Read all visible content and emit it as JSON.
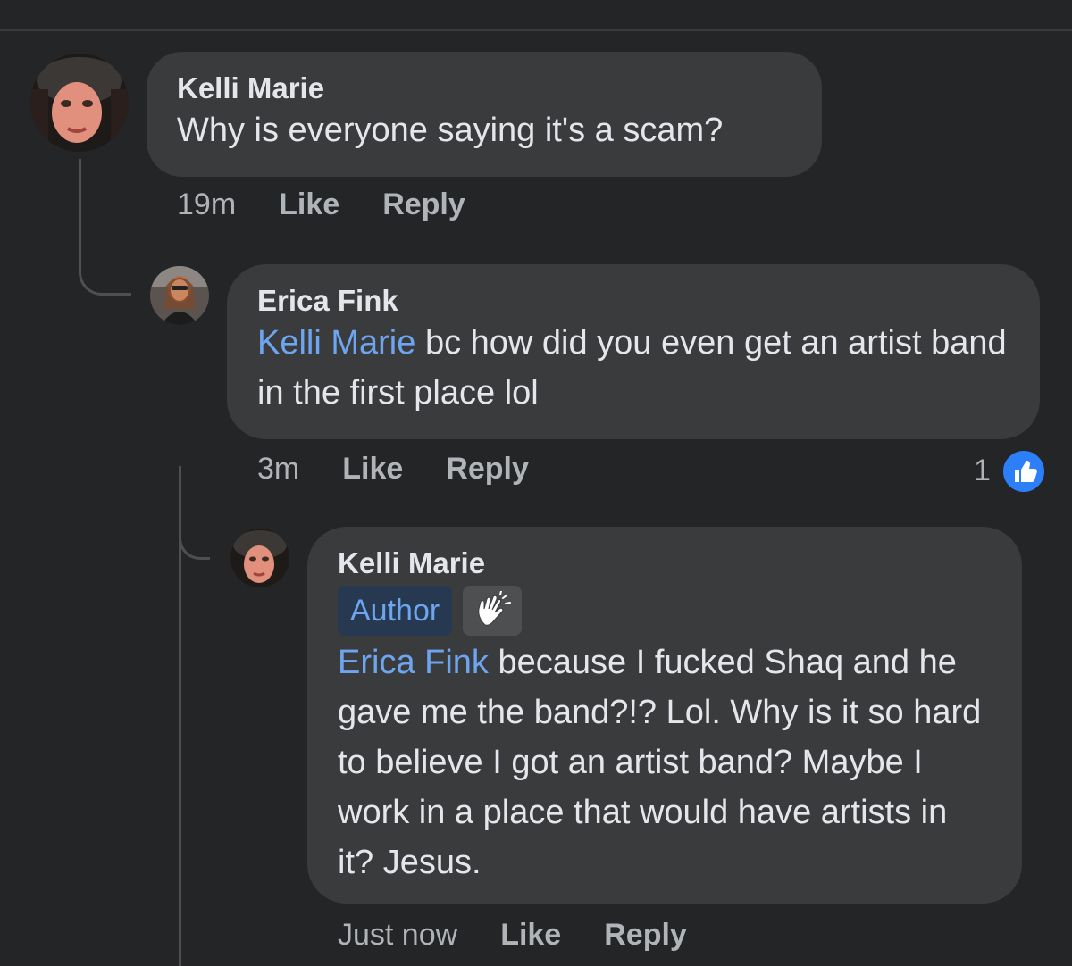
{
  "comments": [
    {
      "author": "Kelli Marie",
      "text": "Why is everyone saying it's a scam?",
      "time": "19m",
      "like_label": "Like",
      "reply_label": "Reply"
    },
    {
      "author": "Erica Fink",
      "mention": "Kelli Marie",
      "text": " bc how did you even get an artist band in the first place lol",
      "time": "3m",
      "like_label": "Like",
      "reply_label": "Reply",
      "reaction_count": "1",
      "reaction_icon": "thumbs-up-icon"
    },
    {
      "author": "Kelli Marie",
      "badge": "Author",
      "badge_icon": "waving-hand-icon",
      "mention": "Erica Fink",
      "text": " because I fucked Shaq and he gave me the band?!?  Lol. Why is it so hard to believe I got an artist band? Maybe I work in a place that would have artists in it? Jesus.",
      "time": "Just now",
      "like_label": "Like",
      "reply_label": "Reply"
    }
  ],
  "colors": {
    "background": "#242526",
    "bubble": "#3a3b3c",
    "mention": "#6ea5f0",
    "like_blue": "#2d7ff9",
    "meta_text": "#b0b3b8"
  }
}
